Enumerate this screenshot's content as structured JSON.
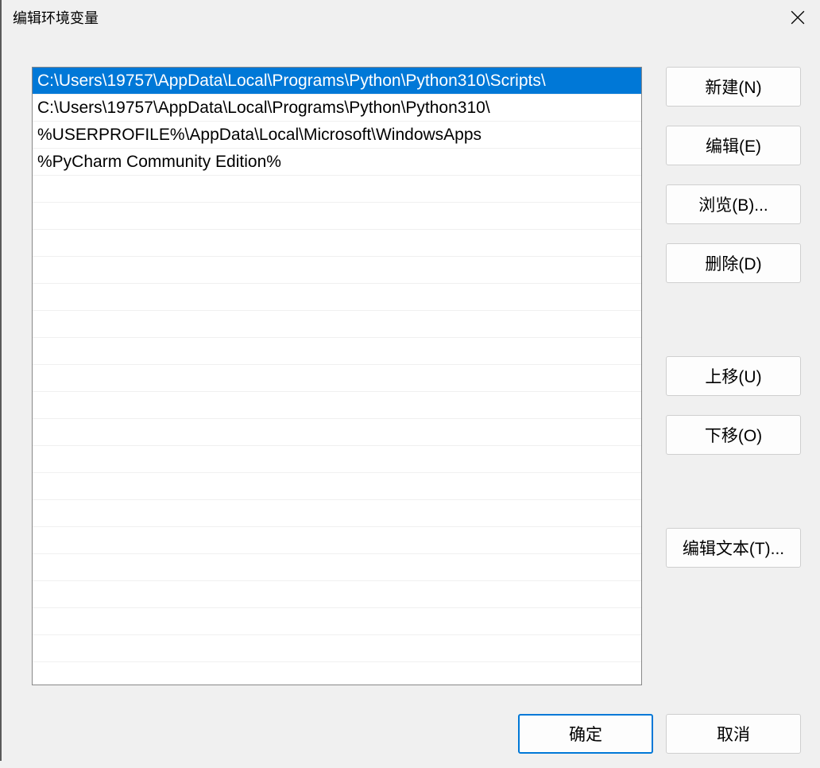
{
  "window": {
    "title": "编辑环境变量"
  },
  "list": {
    "items": [
      "C:\\Users\\19757\\AppData\\Local\\Programs\\Python\\Python310\\Scripts\\",
      "C:\\Users\\19757\\AppData\\Local\\Programs\\Python\\Python310\\",
      "%USERPROFILE%\\AppData\\Local\\Microsoft\\WindowsApps",
      "%PyCharm Community Edition%"
    ],
    "selectedIndex": 0,
    "visibleRows": 22
  },
  "buttons": {
    "new": "新建(N)",
    "edit": "编辑(E)",
    "browse": "浏览(B)...",
    "delete": "删除(D)",
    "moveUp": "上移(U)",
    "moveDown": "下移(O)",
    "editText": "编辑文本(T)...",
    "ok": "确定",
    "cancel": "取消"
  }
}
